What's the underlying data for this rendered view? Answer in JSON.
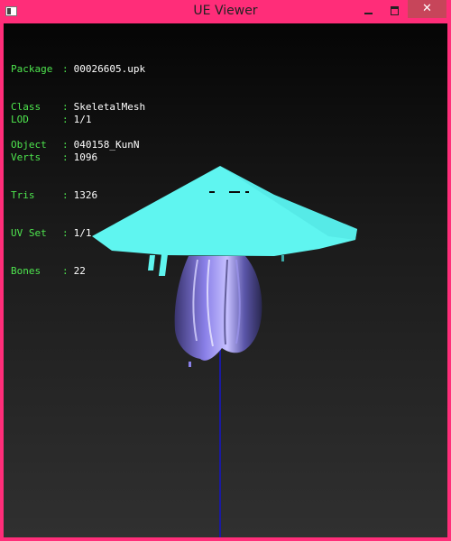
{
  "window": {
    "title": "UE Viewer",
    "close_glyph": "✕",
    "minimize_icon": "minimize-icon",
    "maximize_icon": "maximize-icon",
    "close_icon": "close-icon",
    "border_color": "#ff2d79"
  },
  "info": {
    "object_block": [
      {
        "label": "Package",
        "value": "00026605.upk"
      },
      {
        "label": "Class",
        "value": "SkeletalMesh"
      },
      {
        "label": "Object",
        "value": "040158_KunN"
      }
    ],
    "stats_block": [
      {
        "label": "LOD",
        "value": "1/1"
      },
      {
        "label": "Verts",
        "value": "1096"
      },
      {
        "label": "Tris",
        "value": "1326"
      },
      {
        "label": "UV Set",
        "value": "1/1"
      },
      {
        "label": "Bones",
        "value": "22"
      }
    ],
    "label_color": "#4ee54e",
    "value_color": "#ffffff"
  },
  "scene": {
    "hat_color": "#5ff5f0",
    "hair_color": "#7b6fd8",
    "axis_color": "#1a1aa0"
  }
}
